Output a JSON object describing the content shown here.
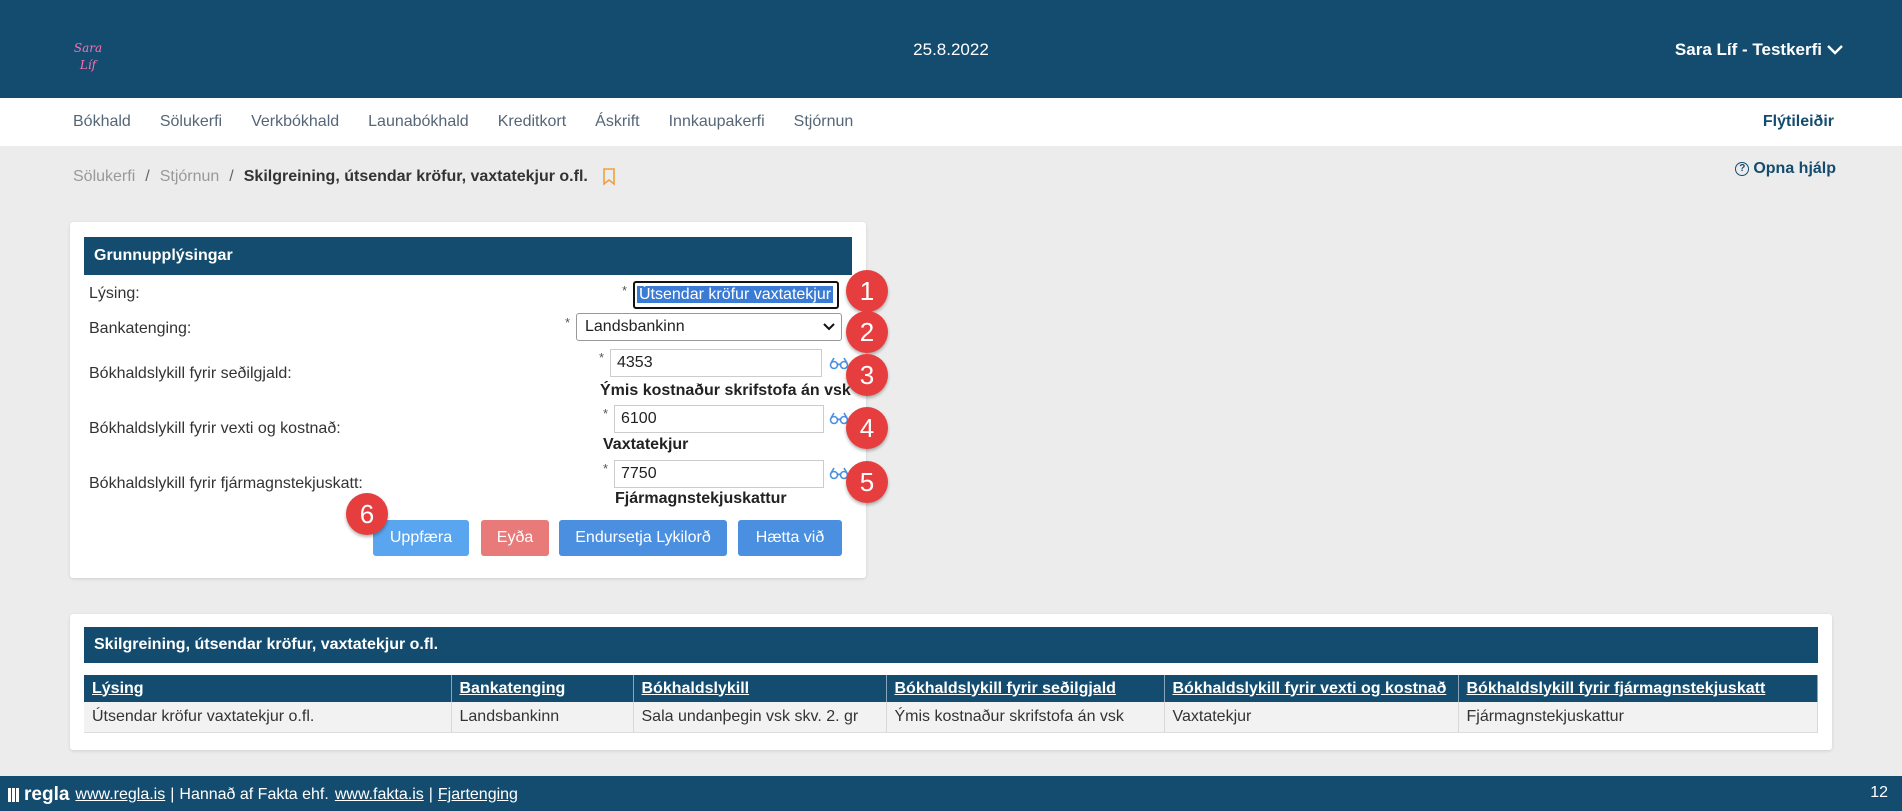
{
  "header": {
    "logo_line1": "Sara",
    "logo_line2": "Líf",
    "date": "25.8.2022",
    "user": "Sara Líf - Testkerfi"
  },
  "nav": {
    "items": [
      "Bókhald",
      "Sölukerfi",
      "Verkbókhald",
      "Launabókhald",
      "Kreditkort",
      "Áskrift",
      "Innkaupakerfi",
      "Stjórnun"
    ],
    "right": "Flýtileiðir"
  },
  "breadcrumb": {
    "items": [
      "Sölukerfi",
      "Stjórnun"
    ],
    "separator": "/",
    "current": "Skilgreining, útsendar kröfur, vaxtatekjur o.fl."
  },
  "help": {
    "label": "Opna hjálp"
  },
  "form": {
    "title": "Grunnupplýsingar",
    "required_mark": "*",
    "fields": {
      "lysing": {
        "label": "Lýsing:",
        "value": "Útsendar kröfur vaxtatekjur"
      },
      "bankatenging": {
        "label": "Bankatenging:",
        "value": "Landsbankinn"
      },
      "sedilgjald": {
        "label": "Bókhaldslykill fyrir seðilgjald:",
        "value": "4353",
        "account_name": "Ýmis kostnaður skrifstofa án vsk"
      },
      "vextir": {
        "label": "Bókhaldslykill fyrir vexti og kostnað:",
        "value": "6100",
        "account_name": "Vaxtatekjur"
      },
      "fjarmagn": {
        "label": "Bókhaldslykill fyrir fjármagnstekjuskatt:",
        "value": "7750",
        "account_name": "Fjármagnstekjuskattur"
      }
    },
    "buttons": {
      "update": "Uppfæra",
      "delete": "Eyða",
      "reset_password": "Endursetja Lykilorð",
      "cancel": "Hætta við"
    }
  },
  "badges": [
    "1",
    "2",
    "3",
    "4",
    "5",
    "6"
  ],
  "table": {
    "title": "Skilgreining, útsendar kröfur, vaxtatekjur o.fl.",
    "columns": [
      "Lýsing",
      "Bankatenging",
      "Bókhaldslykill",
      "Bókhaldslykill fyrir seðilgjald",
      "Bókhaldslykill fyrir vexti og kostnað",
      "Bókhaldslykill fyrir fjármagnstekjuskatt"
    ],
    "rows": [
      [
        "Útsendar kröfur vaxtatekjur o.fl.",
        "Landsbankinn",
        "Sala undanþegin vsk skv. 2. gr",
        "Ýmis kostnaður skrifstofa án vsk",
        "Vaxtatekjur",
        "Fjármagnstekjuskattur"
      ]
    ]
  },
  "footer": {
    "logo": "regla",
    "link1": "www.regla.is",
    "sep": "|",
    "text": "Hannað af Fakta ehf.",
    "link2": "www.fakta.is",
    "link3": "Fjartenging",
    "page_number": "12"
  },
  "colors": {
    "primary": "#134c6e",
    "badge": "#e63e3e",
    "button": "#4a8fe0",
    "danger": "#e87a7a",
    "accent": "#f0a040"
  }
}
